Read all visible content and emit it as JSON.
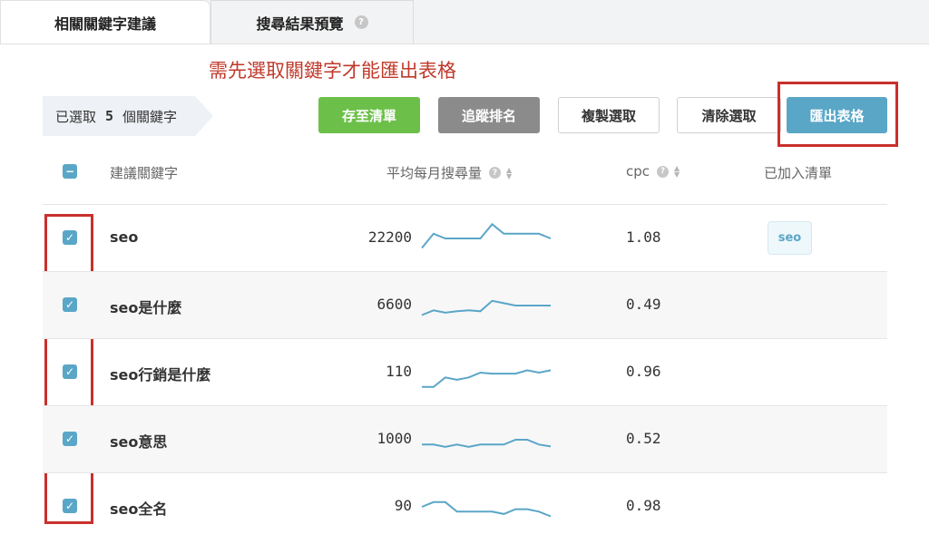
{
  "tabs": [
    {
      "label": "相關關鍵字建議"
    },
    {
      "label": "搜尋結果預覽",
      "help": "?"
    }
  ],
  "notice": "需先選取關鍵字才能匯出表格",
  "selection": {
    "prefix": "已選取",
    "count": "5",
    "suffix": "個關鍵字"
  },
  "toolbar": {
    "save_label": "存至清單",
    "track_label": "追蹤排名",
    "copy_label": "複製選取",
    "clear_label": "清除選取",
    "export_label": "匯出表格"
  },
  "table": {
    "headers": {
      "select_all": "−",
      "keyword": "建議關鍵字",
      "volume": "平均每月搜尋量",
      "cpc": "cpc",
      "list": "已加入清單",
      "help": "?",
      "sort_up": "▲",
      "sort_down": "▼"
    },
    "rows": [
      {
        "checked": "✓",
        "keyword": "seo",
        "volume": "22200",
        "cpc": "1.08",
        "list_tag": "seo",
        "trend": [
          2,
          5,
          4,
          4,
          4,
          4,
          7,
          5,
          5,
          5,
          5,
          4
        ]
      },
      {
        "checked": "✓",
        "keyword": "seo是什麼",
        "volume": "6600",
        "cpc": "0.49",
        "list_tag": "",
        "trend": [
          2,
          3,
          2.5,
          2.8,
          3,
          2.8,
          5,
          4.5,
          4,
          4,
          4,
          4
        ]
      },
      {
        "checked": "✓",
        "keyword": "seo行銷是什麼",
        "volume": "110",
        "cpc": "0.96",
        "list_tag": "",
        "trend": [
          1,
          1,
          3,
          2.5,
          3,
          4,
          3.8,
          3.8,
          3.8,
          4.5,
          4,
          4.5
        ]
      },
      {
        "checked": "✓",
        "keyword": "seo意思",
        "volume": "1000",
        "cpc": "0.52",
        "list_tag": "",
        "trend": [
          3,
          3,
          2.5,
          3,
          2.5,
          3,
          3,
          3,
          4,
          4,
          3,
          2.6
        ]
      },
      {
        "checked": "✓",
        "keyword": "seo全名",
        "volume": "90",
        "cpc": "0.98",
        "list_tag": "",
        "trend": [
          4,
          5,
          5,
          3,
          3,
          3,
          3,
          2.5,
          3.5,
          3.5,
          3,
          2
        ]
      }
    ]
  },
  "colors": {
    "accent": "#5aa6c7",
    "green": "#6cc04a",
    "gray": "#8b8b8b",
    "annotation_red": "#c9302c",
    "notice_red": "#c0392b",
    "spark": "#5aa6c7"
  }
}
